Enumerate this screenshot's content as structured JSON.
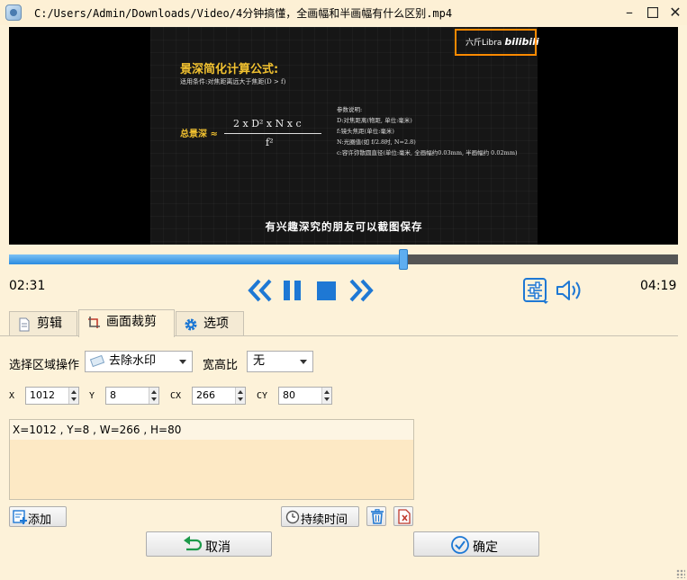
{
  "window": {
    "title": "C:/Users/Admin/Downloads/Video/4分钟搞懂，全画幅和半画幅有什么区别.mp4"
  },
  "video": {
    "title": "景深简化计算公式:",
    "condition": "适用条件:对焦距离远大于焦距(D > f)",
    "formula_label": "总景深 ≈",
    "formula_numerator": "2 x D² x N x c",
    "formula_denominator": "f²",
    "notes": [
      "参数说明:",
      "D:对焦距离(物距, 单位:毫米)",
      "f:镜头焦距(单位:毫米)",
      "N:光圈值(如 f/2.8时, N=2.8)",
      "c:容许弥散圆直径(单位:毫米, 全画幅约0.03mm, 半画幅约 0.02mm)"
    ],
    "subtitle": "有兴趣深究的朋友可以截图保存",
    "watermark_text": "六斤Libra",
    "watermark_logo": "bilibili"
  },
  "player": {
    "progress": 0.59,
    "current_time": "02:31",
    "total_time": "04:19",
    "accent_color": "#2a8ce0"
  },
  "tabs": [
    {
      "label": "剪辑",
      "icon": "document-icon"
    },
    {
      "label": "画面裁剪",
      "icon": "crop-icon"
    },
    {
      "label": "选项",
      "icon": "gear-icon"
    }
  ],
  "crop": {
    "region_op_label": "选择区域操作",
    "region_op_value": "去除水印",
    "ratio_label": "宽高比",
    "ratio_value": "无",
    "x_label": "X",
    "x_value": "1012",
    "y_label": "Y",
    "y_value": "8",
    "cx_label": "CX",
    "cx_value": "266",
    "cy_label": "CY",
    "cy_value": "80",
    "regions": [
      "X=1012 , Y=8 , W=266 , H=80"
    ],
    "add_label": "添加",
    "duration_label": "持续时间"
  },
  "footer": {
    "cancel_label": "取消",
    "ok_label": "确定"
  }
}
